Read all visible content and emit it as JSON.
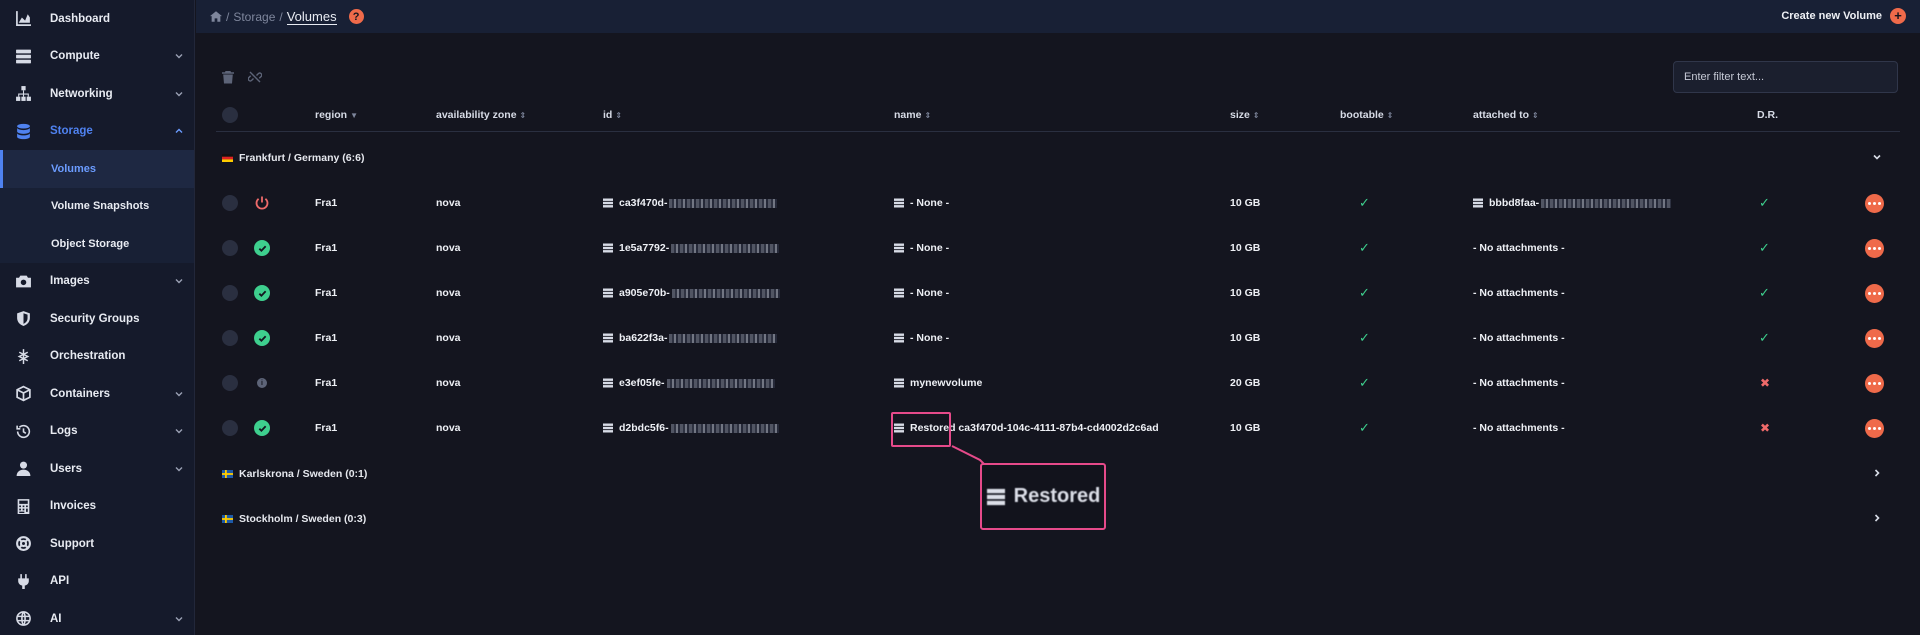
{
  "sidebar": {
    "items": [
      {
        "label": "Dashboard",
        "icon": "chart-icon"
      },
      {
        "label": "Compute",
        "icon": "server-icon"
      },
      {
        "label": "Networking",
        "icon": "network-icon"
      },
      {
        "label": "Storage",
        "icon": "database-icon"
      },
      {
        "label": "Images",
        "icon": "camera-icon"
      },
      {
        "label": "Security Groups",
        "icon": "shield-icon"
      },
      {
        "label": "Orchestration",
        "icon": "orchestration-icon"
      },
      {
        "label": "Containers",
        "icon": "cube-icon"
      },
      {
        "label": "Logs",
        "icon": "history-icon"
      },
      {
        "label": "Users",
        "icon": "user-icon"
      },
      {
        "label": "Invoices",
        "icon": "calculator-icon"
      },
      {
        "label": "Support",
        "icon": "lifebuoy-icon"
      },
      {
        "label": "API",
        "icon": "plug-icon"
      },
      {
        "label": "AI",
        "icon": "ai-icon"
      }
    ],
    "storage_sub": [
      "Volumes",
      "Volume Snapshots",
      "Object Storage"
    ]
  },
  "topbar": {
    "crumb_storage": "Storage",
    "crumb_current": "Volumes",
    "help": "?",
    "create_label": "Create new Volume"
  },
  "filter": {
    "placeholder": "Enter filter text..."
  },
  "columns": [
    "region",
    "availability zone",
    "id",
    "name",
    "size",
    "bootable",
    "attached to",
    "D.R."
  ],
  "groups": [
    {
      "label": "Frankfurt / Germany (6:6)"
    },
    {
      "label": "Karlskrona / Sweden (0:1)"
    },
    {
      "label": "Stockholm / Sweden (0:3)"
    }
  ],
  "rows": [
    {
      "status": "power",
      "region": "Fra1",
      "az": "nova",
      "id": "ca3f470d-",
      "name": "- None -",
      "size": "10 GB",
      "bootable": true,
      "attached": "bbbd8faa-",
      "attached_blurred": true,
      "dr": true
    },
    {
      "status": "ok",
      "region": "Fra1",
      "az": "nova",
      "id": "1e5a7792-",
      "name": "- None -",
      "size": "10 GB",
      "bootable": true,
      "attached": "- No attachments -",
      "attached_blurred": false,
      "dr": true
    },
    {
      "status": "ok",
      "region": "Fra1",
      "az": "nova",
      "id": "a905e70b-",
      "name": "- None -",
      "size": "10 GB",
      "bootable": true,
      "attached": "- No attachments -",
      "attached_blurred": false,
      "dr": true
    },
    {
      "status": "ok",
      "region": "Fra1",
      "az": "nova",
      "id": "ba622f3a-",
      "name": "- None -",
      "size": "10 GB",
      "bootable": true,
      "attached": "- No attachments -",
      "attached_blurred": false,
      "dr": true
    },
    {
      "status": "info",
      "region": "Fra1",
      "az": "nova",
      "id": "e3ef05fe-",
      "name": "mynewvolume",
      "size": "20 GB",
      "bootable": true,
      "attached": "- No attachments -",
      "attached_blurred": false,
      "dr": false
    },
    {
      "status": "ok",
      "region": "Fra1",
      "az": "nova",
      "id": "d2bdc5f6-",
      "name": "Restored ca3f470d-104c-4111-87b4-cd4002d2c6ad",
      "size": "10 GB",
      "bootable": true,
      "attached": "- No attachments -",
      "attached_blurred": false,
      "dr": false
    }
  ],
  "zoom_callout": "Restored",
  "colors": {
    "accent": "#4f82f0",
    "action": "#ef6a4a",
    "success": "#3ecf8e",
    "danger": "#ef6a6a",
    "highlight": "#e64a8a"
  }
}
